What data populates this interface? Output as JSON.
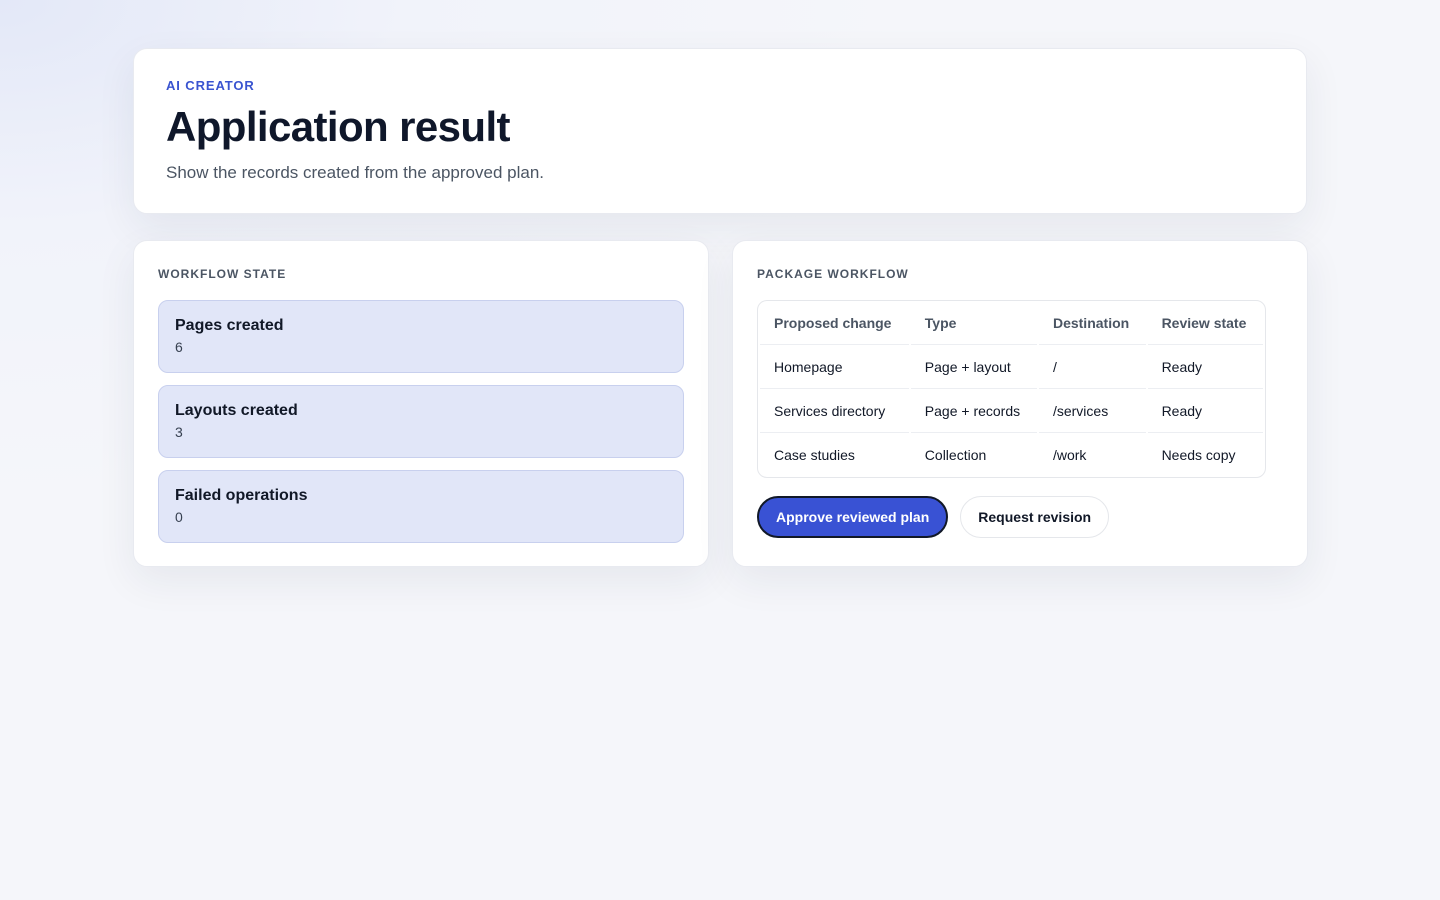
{
  "header": {
    "eyebrow": "AI CREATOR",
    "title": "Application result",
    "subtitle": "Show the records created from the approved plan."
  },
  "workflow_state": {
    "title": "WORKFLOW STATE",
    "stats": [
      {
        "label": "Pages created",
        "value": "6"
      },
      {
        "label": "Layouts created",
        "value": "3"
      },
      {
        "label": "Failed operations",
        "value": "0"
      }
    ]
  },
  "package_workflow": {
    "title": "PACKAGE WORKFLOW",
    "columns": [
      "Proposed change",
      "Type",
      "Destination",
      "Review state"
    ],
    "rows": [
      [
        "Homepage",
        "Page + layout",
        "/",
        "Ready"
      ],
      [
        "Services directory",
        "Page + records",
        "/services",
        "Ready"
      ],
      [
        "Case studies",
        "Collection",
        "/work",
        "Needs copy"
      ]
    ],
    "actions": {
      "approve_label": "Approve reviewed plan",
      "revision_label": "Request revision"
    }
  },
  "colors": {
    "accent": "#3952d4",
    "stat_bg": "#e1e6f8"
  }
}
